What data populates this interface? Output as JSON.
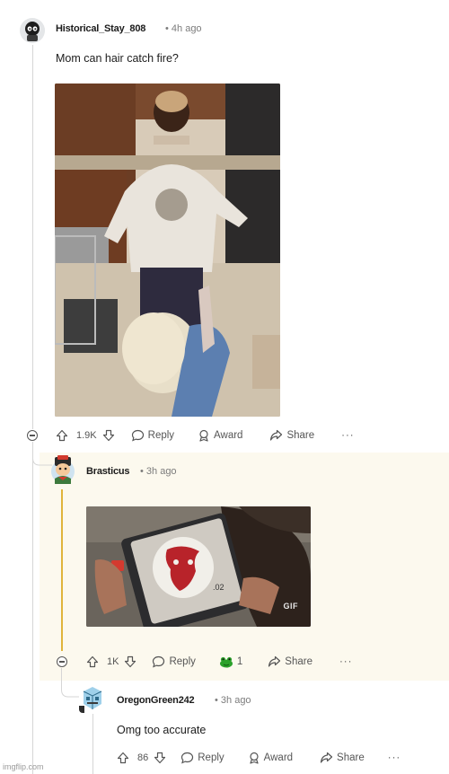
{
  "comments": [
    {
      "username": "Historical_Stay_808",
      "time": "• 4h ago",
      "body": "Mom can hair catch fire?",
      "votes": "1.9K",
      "actions": {
        "reply": "Reply",
        "award": "Award",
        "share": "Share",
        "more": "···"
      }
    },
    {
      "username": "Brasticus",
      "time": "• 3h ago",
      "gif_badge": "GIF",
      "votes": "1K",
      "award_count": "1",
      "actions": {
        "reply": "Reply",
        "share": "Share",
        "more": "···"
      }
    },
    {
      "username": "OregonGreen242",
      "time": "• 3h ago",
      "body": "Omg too accurate",
      "votes": "86",
      "actions": {
        "reply": "Reply",
        "award": "Award",
        "share": "Share",
        "more": "···"
      }
    }
  ],
  "watermark": "imgflip.com",
  "colors": {
    "highlight_bg": "#fcf9ee",
    "thread_highlight": "#e0b43b",
    "award_green": "#2ca12b"
  }
}
